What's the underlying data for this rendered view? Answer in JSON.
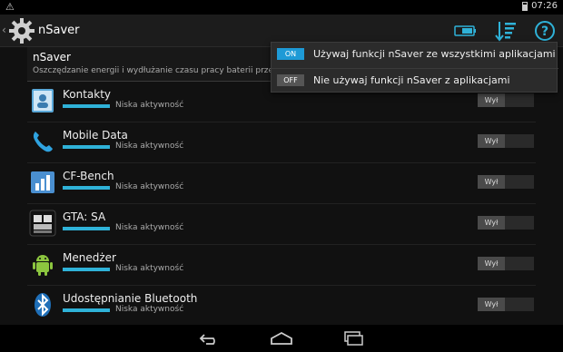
{
  "status_bar": {
    "time": "07:26",
    "warning_icon": "warning-icon"
  },
  "action_bar": {
    "title": "nSaver",
    "icons": [
      "back-chevron-icon",
      "gear-icon",
      "battery-toggle-icon",
      "sort-icon",
      "help-icon"
    ]
  },
  "header": {
    "title": "nSaver",
    "subtitle": "Oszczędzanie energii i wydłużanie czasu pracy baterii przez zn"
  },
  "apps": [
    {
      "name": "Kontakty",
      "activity": "Niska aktywność",
      "toggle": "Wył",
      "icon": "contacts-icon"
    },
    {
      "name": "Mobile Data",
      "activity": "Niska aktywność",
      "toggle": "Wył",
      "icon": "phone-icon"
    },
    {
      "name": "CF-Bench",
      "activity": "Niska aktywność",
      "toggle": "Wył",
      "icon": "bar-chart-icon"
    },
    {
      "name": "GTA: SA",
      "activity": "Niska aktywność",
      "toggle": "Wył",
      "icon": "gta-icon"
    },
    {
      "name": "Menedżer",
      "activity": "Niska aktywność",
      "toggle": "Wył",
      "icon": "android-icon"
    },
    {
      "name": "Udostępnianie Bluetooth",
      "activity": "Niska aktywność",
      "toggle": "Wył",
      "icon": "bluetooth-icon"
    }
  ],
  "popup": {
    "items": [
      {
        "badge": "ON",
        "label": "Używaj funkcji nSaver ze wszystkimi aplikacjami"
      },
      {
        "badge": "OFF",
        "label": "Nie używaj funkcji nSaver z aplikacjami"
      }
    ]
  },
  "nav_bar": {
    "icons": [
      "back-icon",
      "home-icon",
      "recent-apps-icon"
    ]
  },
  "colors": {
    "accent": "#2fb2d8",
    "on_badge": "#1e9ad6",
    "background": "#111111"
  }
}
